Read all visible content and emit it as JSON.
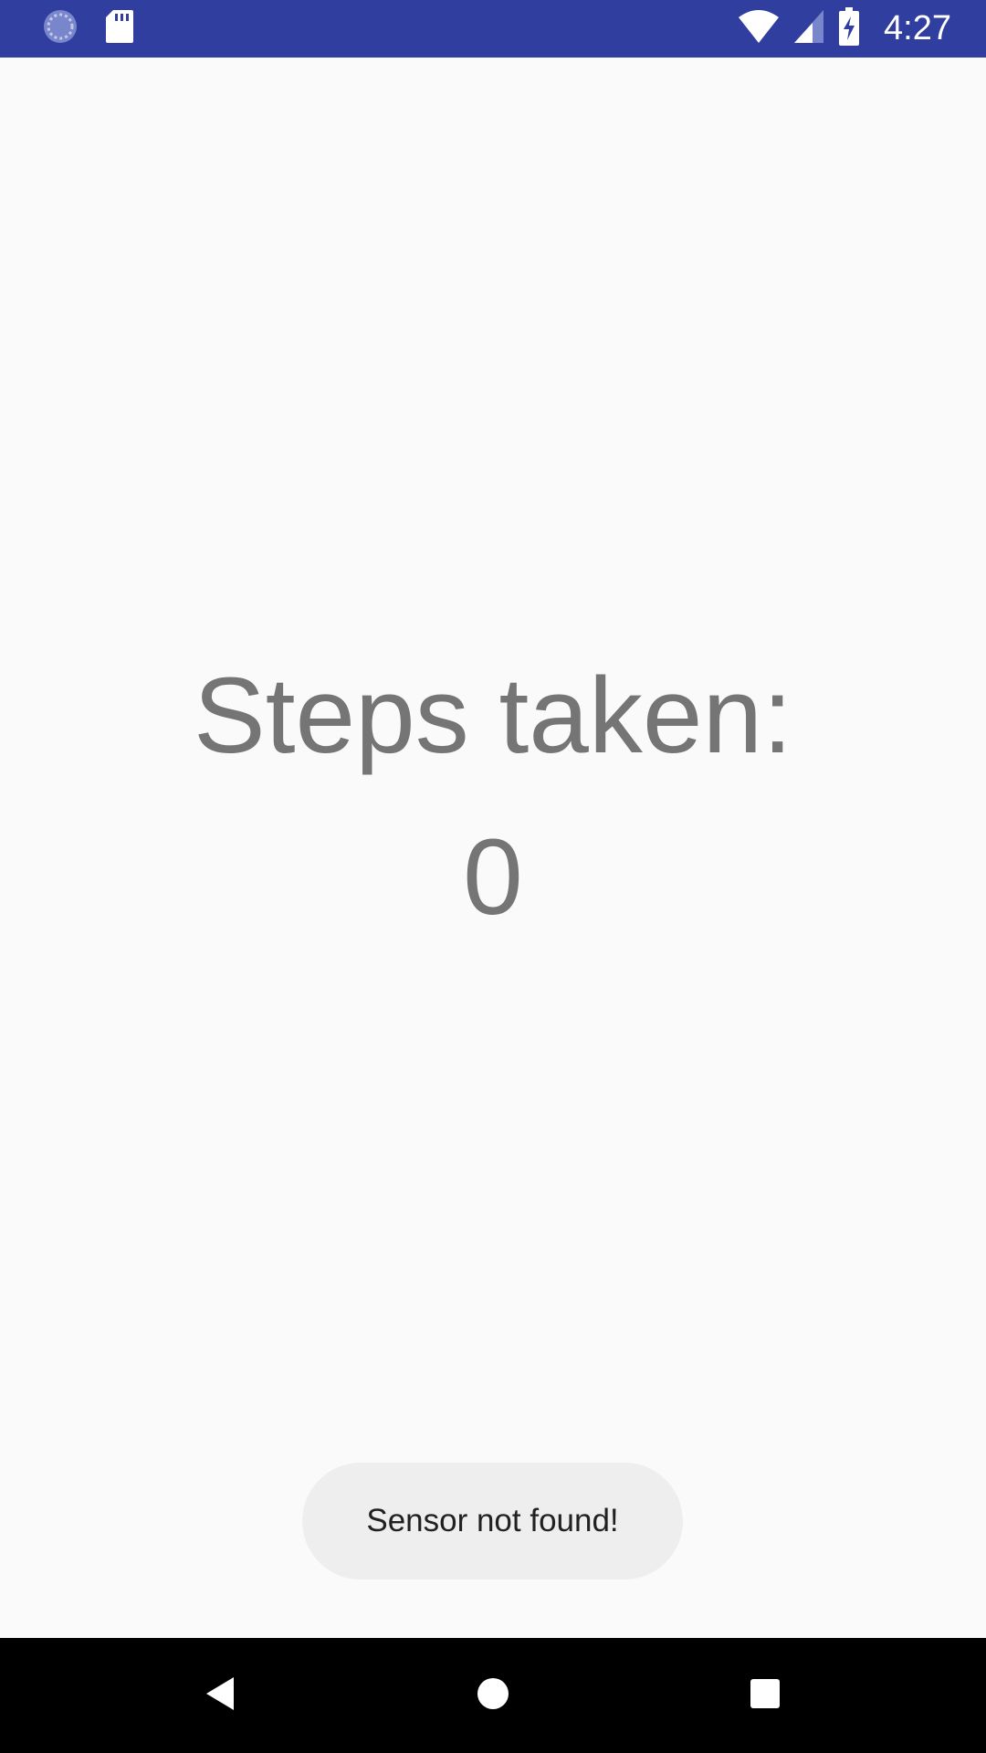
{
  "status_bar": {
    "time": "4:27",
    "background": "#303f9f",
    "left_icons": [
      "sync-icon",
      "sd-card-icon"
    ],
    "right_icons": [
      "wifi-icon",
      "cellular-signal-icon",
      "battery-charging-icon"
    ]
  },
  "main": {
    "steps_label": "Steps taken:",
    "steps_count": "0",
    "text_color": "#757575"
  },
  "toast": {
    "message": "Sensor not found!"
  },
  "nav_bar": {
    "buttons": [
      "back-icon",
      "home-icon",
      "recents-icon"
    ]
  }
}
